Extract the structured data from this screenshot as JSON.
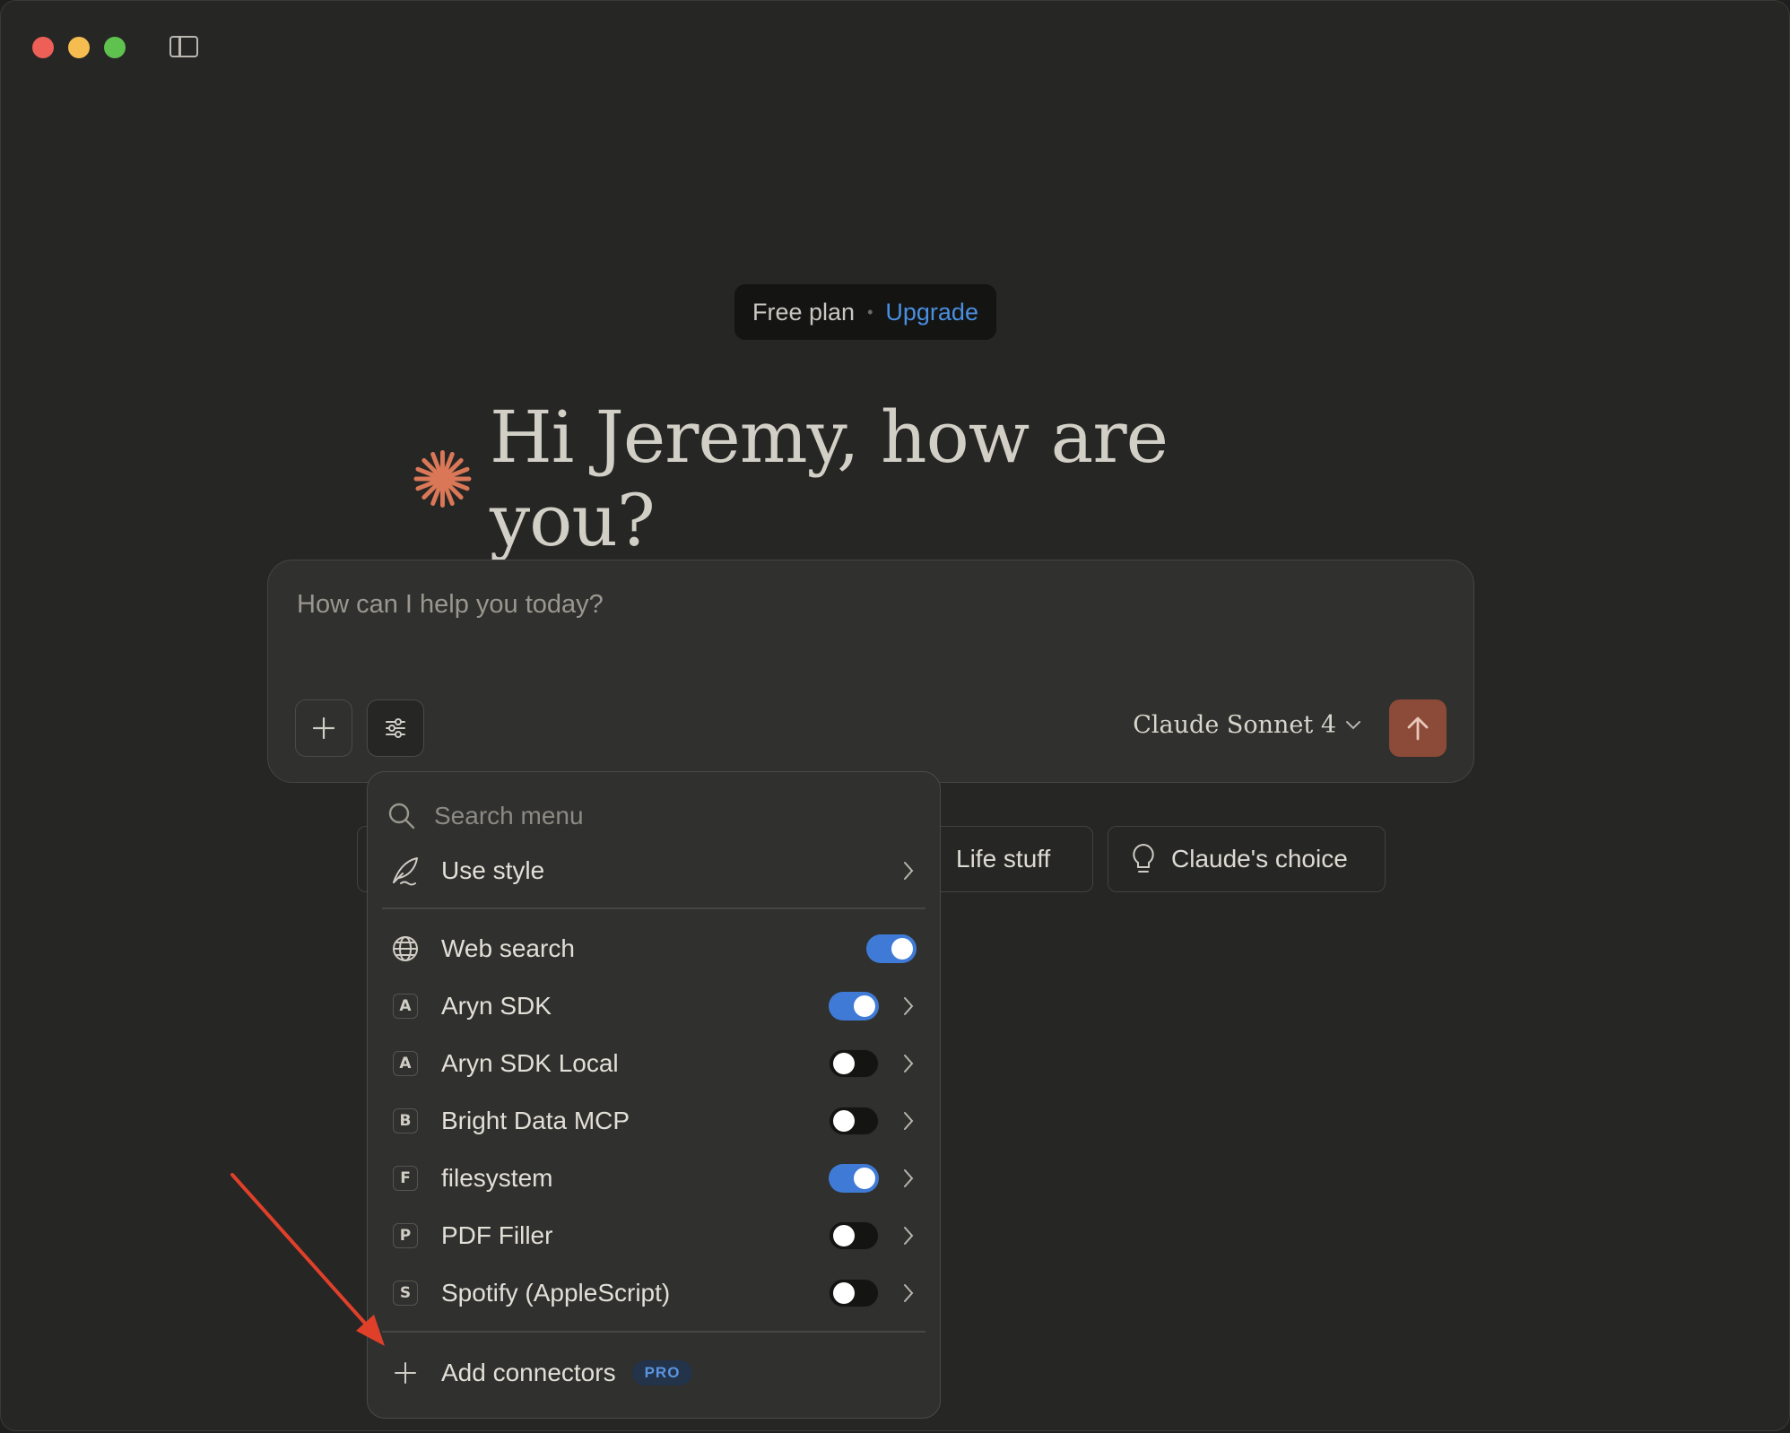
{
  "window": {
    "traffic_lights": [
      "close",
      "minimize",
      "zoom"
    ],
    "sidebar_toggle_icon": "sidebar-toggle-icon"
  },
  "plan": {
    "label": "Free plan",
    "separator": "•",
    "upgrade_label": "Upgrade"
  },
  "greeting": {
    "icon": "claude-asterisk-icon",
    "text": "Hi Jeremy, how are you?"
  },
  "composer": {
    "placeholder": "How can I help you today?",
    "model": "Claude Sonnet 4",
    "add_icon": "plus-icon",
    "tools_icon": "sliders-icon",
    "send_icon": "arrow-up-icon"
  },
  "chips": [
    {
      "label": "Life stuff",
      "icon": "coffee-icon"
    },
    {
      "label": "Claude's choice",
      "icon": "lightbulb-icon"
    }
  ],
  "menu": {
    "search_placeholder": "Search menu",
    "use_style": {
      "label": "Use style",
      "icon": "quill-icon"
    },
    "web_search": {
      "label": "Web search",
      "icon": "globe-icon",
      "enabled": true
    },
    "connectors": [
      {
        "letter": "A",
        "label": "Aryn SDK",
        "enabled": true
      },
      {
        "letter": "A",
        "label": "Aryn SDK Local",
        "enabled": false
      },
      {
        "letter": "B",
        "label": "Bright Data MCP",
        "enabled": false
      },
      {
        "letter": "F",
        "label": "filesystem",
        "enabled": true
      },
      {
        "letter": "P",
        "label": "PDF Filler",
        "enabled": false
      },
      {
        "letter": "S",
        "label": "Spotify (AppleScript)",
        "enabled": false
      }
    ],
    "add_connectors": {
      "label": "Add connectors",
      "badge": "PRO"
    }
  },
  "colors": {
    "accent": "#3f7bd6",
    "brand": "#d97757",
    "annotation_arrow": "#e0402a"
  }
}
